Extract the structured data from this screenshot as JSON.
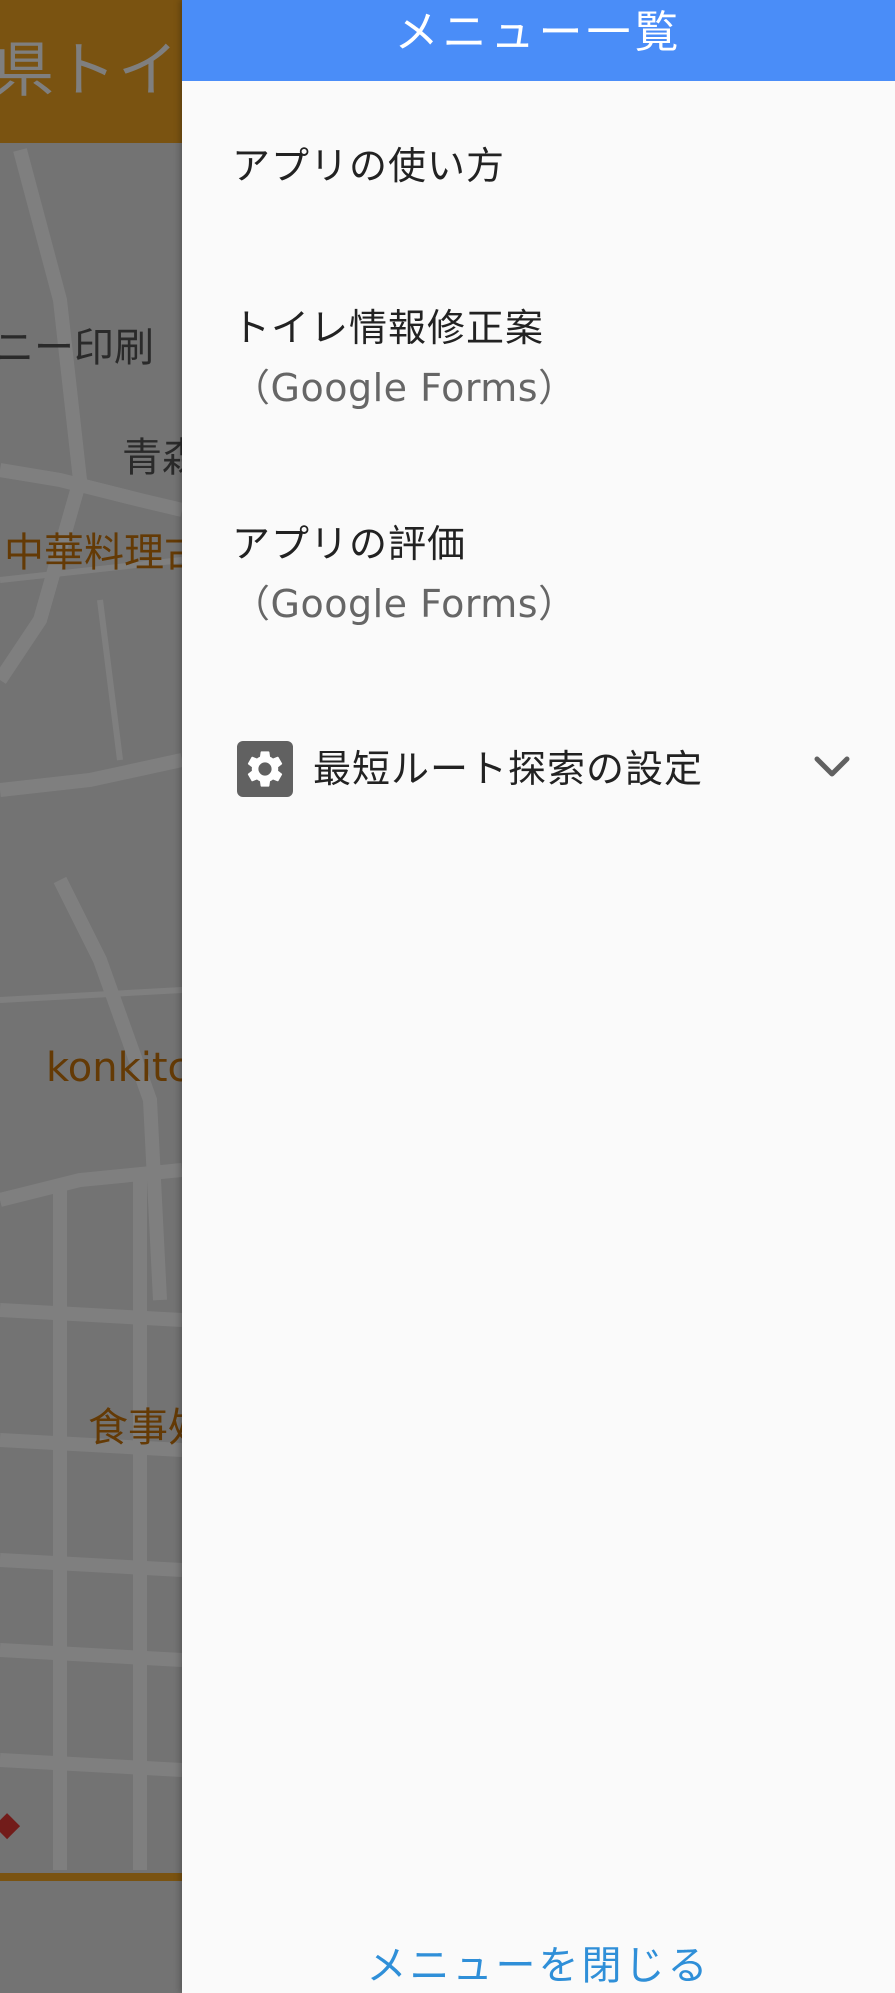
{
  "background_map": {
    "header_title": "県トイレ",
    "labels": [
      "ニー印刷",
      "青森",
      "中華料理古",
      "konkitch",
      "食事処"
    ],
    "colors": {
      "header": "#f5a623",
      "poi_label": "#c8740a",
      "place_label": "#555555"
    }
  },
  "drawer": {
    "header_title": "メニュー一覧",
    "items": [
      {
        "title": "アプリの使い方"
      },
      {
        "title": "トイレ情報修正案",
        "subtitle": "（Google Forms）"
      },
      {
        "title": "アプリの評価",
        "subtitle": "（Google Forms）"
      }
    ],
    "settings_item": {
      "icon": "gear-icon",
      "label": "最短ルート探索の設定",
      "expand_icon": "chevron-down-icon"
    },
    "close_label": "メニューを閉じる",
    "colors": {
      "header": "#4a8df8",
      "close_link": "#2f8fd8",
      "background": "#fafafa"
    }
  }
}
